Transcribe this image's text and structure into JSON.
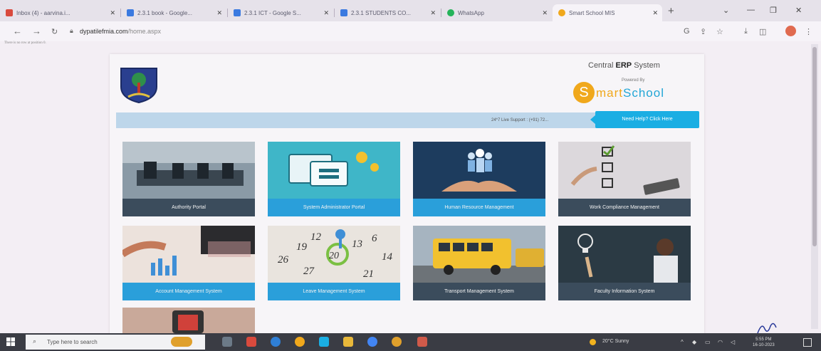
{
  "browser": {
    "tabs": [
      {
        "title": "Inbox (4) - aarvina.i...",
        "favicon": "gmail-icon",
        "color": "#d94a3d"
      },
      {
        "title": "2.3.1 book - Google...",
        "favicon": "docs-icon",
        "color": "#3b7ae0"
      },
      {
        "title": "2.3.1 ICT - Google S...",
        "favicon": "docs-icon",
        "color": "#3b7ae0"
      },
      {
        "title": "2.3.1 STUDENTS CO...",
        "favicon": "docs-icon",
        "color": "#3b7ae0"
      },
      {
        "title": "WhatsApp",
        "favicon": "whatsapp-icon",
        "color": "#25b35a"
      },
      {
        "title": "Smart School MIS",
        "favicon": "smartschool-icon",
        "color": "#f0a81c"
      }
    ],
    "url_host": "dypatilefmia.com",
    "url_path": "/home.aspx"
  },
  "page": {
    "error_text": "There is no row at position 0.",
    "erp_title_prefix": "Central ",
    "erp_title_bold": "ERP",
    "erp_title_suffix": " System",
    "powered_by": "Powered By",
    "brand_letter": "S",
    "brand_rest_1": "mart",
    "brand_rest_2": "School",
    "support_text": "24*7 Live Support : (+91) 72...",
    "help_button": "Need Help? Click Here",
    "tiles": [
      {
        "label": "Authority Portal",
        "bg": "#7a8c99",
        "accent": "#2f3a44"
      },
      {
        "label": "System Administrator Portal",
        "bg": "#3fb6c8",
        "accent": "#f0f6f8"
      },
      {
        "label": "Human Resource Management",
        "bg": "#1d3c5e",
        "accent": "#7fb2e2"
      },
      {
        "label": "Work Compliance Management",
        "bg": "#d9d6da",
        "accent": "#5a7a40"
      },
      {
        "label": "Account Management System",
        "bg": "#e8d8d0",
        "accent": "#8b5a3c"
      },
      {
        "label": "Leave Management System",
        "bg": "#e7e2dc",
        "accent": "#3f8fd6"
      },
      {
        "label": "Transport Management System",
        "bg": "#8f9aa4",
        "accent": "#f2c12e"
      },
      {
        "label": "Faculty Information System",
        "bg": "#2b3a44",
        "accent": "#d9b48a"
      },
      {
        "label": "",
        "bg": "#c9a99a",
        "accent": "#d0413a"
      }
    ]
  },
  "taskbar": {
    "search_placeholder": "Type here to search",
    "weather": "20°C Sunny",
    "time": "5:55 PM",
    "date": "16-10-2023"
  }
}
